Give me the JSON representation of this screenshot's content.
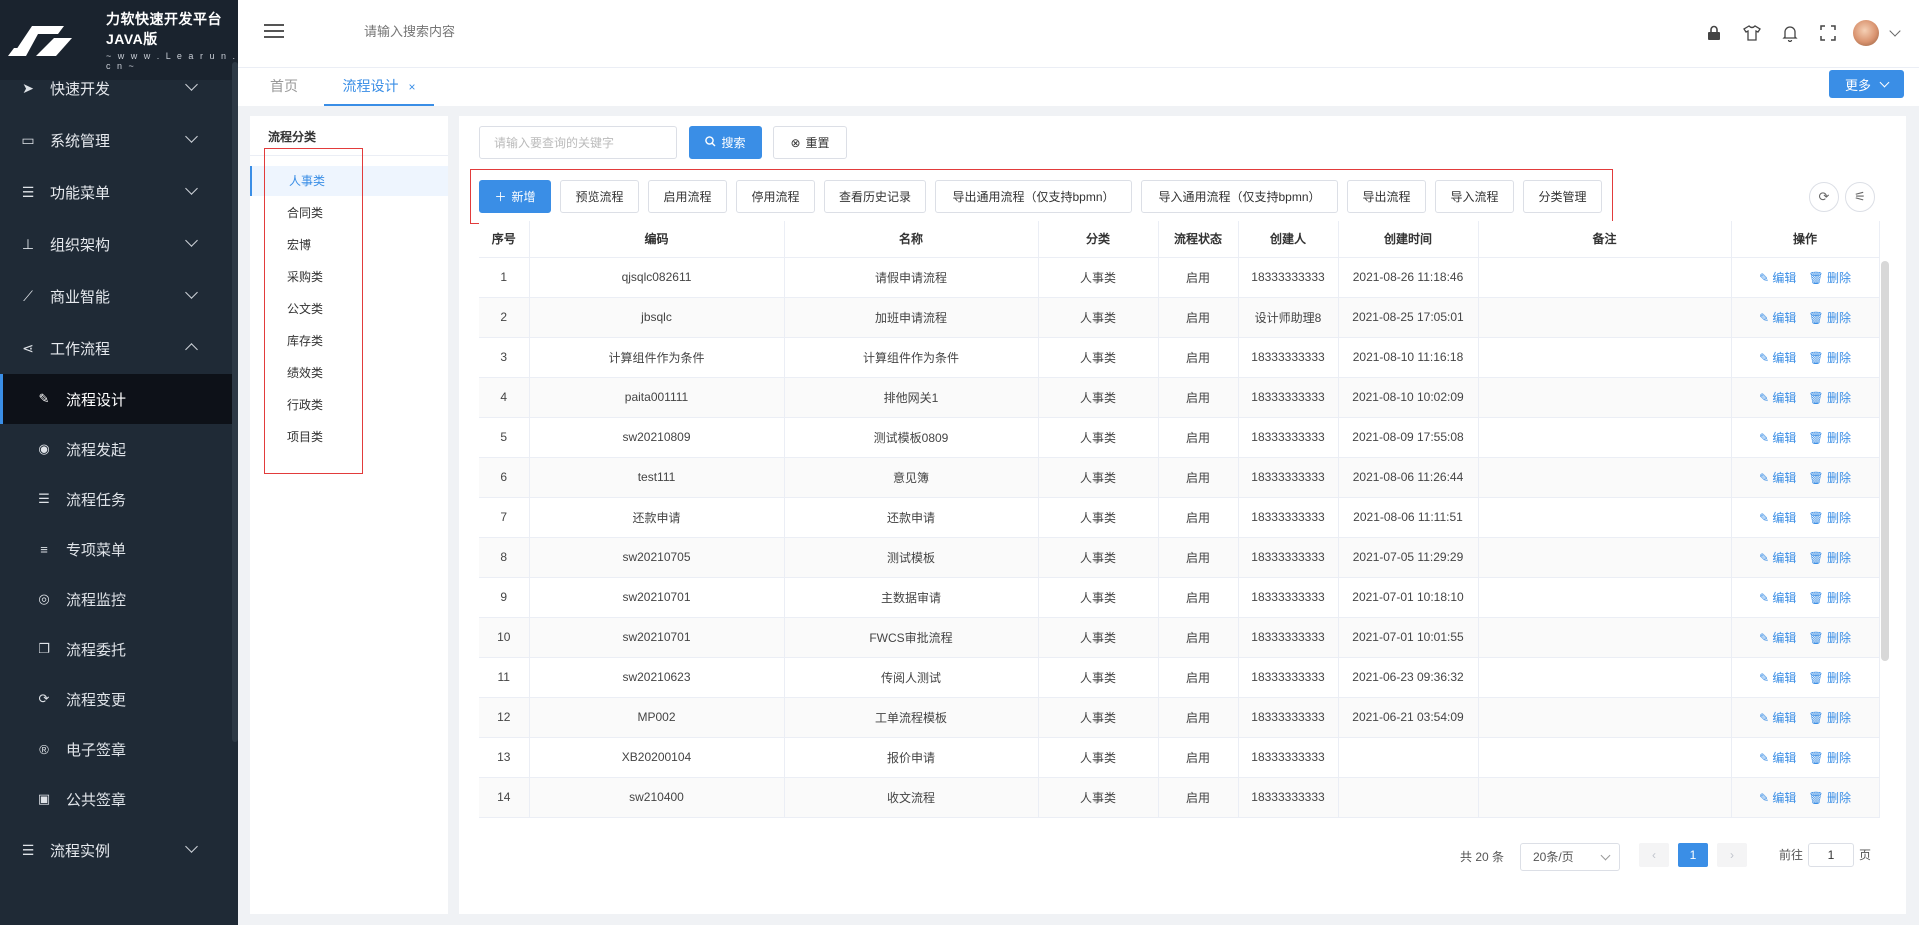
{
  "app": {
    "logo_title": "力软快速开发平台JAVA版",
    "logo_sub": "~ w w w . L e a r u n . c n ~"
  },
  "sidebar": {
    "items": [
      {
        "label": "快速开发",
        "icon": "paper-plane-icon",
        "expanded": false
      },
      {
        "label": "系统管理",
        "icon": "monitor-icon",
        "expanded": false
      },
      {
        "label": "功能菜单",
        "icon": "list-icon",
        "expanded": false
      },
      {
        "label": "组织架构",
        "icon": "org-chart-icon",
        "expanded": false
      },
      {
        "label": "商业智能",
        "icon": "line-chart-icon",
        "expanded": false
      },
      {
        "label": "工作流程",
        "icon": "share-icon",
        "expanded": true
      }
    ],
    "subitems": [
      {
        "label": "流程设计",
        "icon": "edit-icon",
        "glyph": "✎",
        "active": true
      },
      {
        "label": "流程发起",
        "icon": "play-circle-icon",
        "glyph": "◉",
        "active": false
      },
      {
        "label": "流程任务",
        "icon": "tasks-icon",
        "glyph": "☰",
        "active": false
      },
      {
        "label": "专项菜单",
        "icon": "menu-icon",
        "glyph": "≡",
        "active": false
      },
      {
        "label": "流程监控",
        "icon": "eye-icon",
        "glyph": "◎",
        "active": false
      },
      {
        "label": "流程委托",
        "icon": "copy-icon",
        "glyph": "❐",
        "active": false
      },
      {
        "label": "流程变更",
        "icon": "refresh-icon",
        "glyph": "⟳",
        "active": false
      },
      {
        "label": "电子签章",
        "icon": "registered-icon",
        "glyph": "®",
        "active": false
      },
      {
        "label": "公共签章",
        "icon": "stamp-icon",
        "glyph": "▣",
        "active": false
      }
    ],
    "last_item": {
      "label": "流程实例",
      "icon": "list-icon"
    }
  },
  "header": {
    "search_placeholder": "请输入搜索内容"
  },
  "tabs": {
    "home": "首页",
    "active": "流程设计",
    "close": "×",
    "more": "更多"
  },
  "categories": {
    "title": "流程分类",
    "items": [
      "人事类",
      "合同类",
      "宏博",
      "采购类",
      "公文类",
      "库存类",
      "绩效类",
      "行政类",
      "项目类"
    ],
    "active_index": 0
  },
  "toolbar": {
    "keyword_placeholder": "请输入要查询的关键字",
    "search": "搜索",
    "reset": "重置",
    "add": "新增",
    "preview": "预览流程",
    "enable": "启用流程",
    "disable": "停用流程",
    "history": "查看历史记录",
    "export_generic": "导出通用流程（仅支持bpmn）",
    "import_generic": "导入通用流程（仅支持bpmn）",
    "export": "导出流程",
    "import": "导入流程",
    "category_manage": "分类管理"
  },
  "table": {
    "columns": [
      "序号",
      "编码",
      "名称",
      "分类",
      "流程状态",
      "创建人",
      "创建时间",
      "备注",
      "操作"
    ],
    "edit_label": "编辑",
    "delete_label": "删除",
    "rows": [
      [
        "1",
        "qjsqlc082611",
        "请假申请流程",
        "人事类",
        "启用",
        "18333333333",
        "2021-08-26 11:18:46",
        ""
      ],
      [
        "2",
        "jbsqlc",
        "加班申请流程",
        "人事类",
        "启用",
        "设计师助理8",
        "2021-08-25 17:05:01",
        ""
      ],
      [
        "3",
        "计算组件作为条件",
        "计算组件作为条件",
        "人事类",
        "启用",
        "18333333333",
        "2021-08-10 11:16:18",
        ""
      ],
      [
        "4",
        "paita001111",
        "排他网关1",
        "人事类",
        "启用",
        "18333333333",
        "2021-08-10 10:02:09",
        ""
      ],
      [
        "5",
        "sw20210809",
        "测试模板0809",
        "人事类",
        "启用",
        "18333333333",
        "2021-08-09 17:55:08",
        ""
      ],
      [
        "6",
        "test111",
        "意见簿",
        "人事类",
        "启用",
        "18333333333",
        "2021-08-06 11:26:44",
        ""
      ],
      [
        "7",
        "还款申请",
        "还款申请",
        "人事类",
        "启用",
        "18333333333",
        "2021-08-06 11:11:51",
        ""
      ],
      [
        "8",
        "sw20210705",
        "测试模板",
        "人事类",
        "启用",
        "18333333333",
        "2021-07-05 11:29:29",
        ""
      ],
      [
        "9",
        "sw20210701",
        "主数据审请",
        "人事类",
        "启用",
        "18333333333",
        "2021-07-01 10:18:10",
        ""
      ],
      [
        "10",
        "sw20210701",
        "FWCS审批流程",
        "人事类",
        "启用",
        "18333333333",
        "2021-07-01 10:01:55",
        ""
      ],
      [
        "11",
        "sw20210623",
        "传阅人测试",
        "人事类",
        "启用",
        "18333333333",
        "2021-06-23 09:36:32",
        ""
      ],
      [
        "12",
        "MP002",
        "工单流程模板",
        "人事类",
        "启用",
        "18333333333",
        "2021-06-21 03:54:09",
        ""
      ],
      [
        "13",
        "XB20200104",
        "报价申请",
        "人事类",
        "启用",
        "18333333333",
        "",
        ""
      ],
      [
        "14",
        "sw210400",
        "收文流程",
        "人事类",
        "启用",
        "18333333333",
        "",
        ""
      ]
    ]
  },
  "pagination": {
    "total": "共 20 条",
    "page_size": "20条/页",
    "prev": "‹",
    "current": "1",
    "next": "›",
    "goto_label": "前往",
    "goto_value": "1",
    "page_suffix": "页"
  }
}
